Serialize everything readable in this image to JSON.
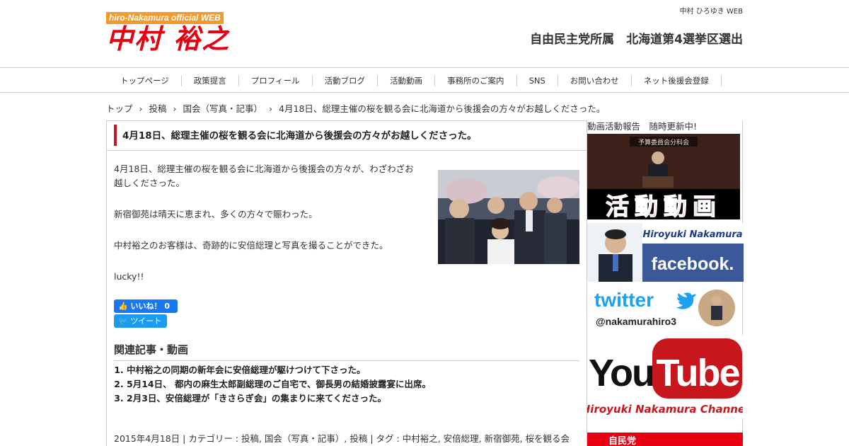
{
  "header": {
    "logo_tag": "hiro-Nakamura official WEB",
    "logo_name": "中村 裕之",
    "top_sub": "中村 ひろゆき WEB",
    "tagline": "自由民主党所属　北海道第4選挙区選出"
  },
  "nav": {
    "items": [
      {
        "label": "トップページ"
      },
      {
        "label": "政策提言"
      },
      {
        "label": "プロフィール"
      },
      {
        "label": "活動ブログ"
      },
      {
        "label": "活動動画"
      },
      {
        "label": "事務所のご案内"
      },
      {
        "label": "SNS"
      },
      {
        "label": "お問い合わせ"
      },
      {
        "label": "ネット後援会登録"
      }
    ]
  },
  "breadcrumb": {
    "items": [
      "トップ",
      "投稿",
      "国会（写真・記事）",
      "4月18日、総理主催の桜を観る会に北海道から後援会の方々がお越しくださった。"
    ]
  },
  "post": {
    "title": "4月18日、総理主催の桜を観る会に北海道から後援会の方々がお越しくださった。",
    "paragraphs": [
      "4月18日、総理主催の桜を観る会に北海道から後援会の方々が、わざわざお越しくださった。",
      "新宿御苑は晴天に恵まれ、多くの方々で賑わった。",
      "中村裕之のお客様は、奇跡的に安倍総理と写真を撮ることができた。",
      "lucky!!"
    ],
    "like_label": "いいね！",
    "like_count": "0",
    "tweet_label": "ツイート",
    "related_heading": "関連記事・動画",
    "related": [
      "中村裕之の同期の新年会に安倍総理が駆けつけて下さった。",
      "5月14日、 都内の麻生太郎副総理のご自宅で、御長男の結婚披露宴に出席。",
      "2月3日、安倍総理が「きさらぎ会」の集まりに来てくださった。"
    ],
    "meta": "2015年4月18日 | カテゴリー : 投稿, 国会（写真・記事）, 投稿 | タグ : 中村裕之, 安倍総理, 新宿御苑, 桜を観る会"
  },
  "sidebar": {
    "heading": "動画活動報告　随時更新中!",
    "video_banner": {
      "top_text": "予算委員会分科会",
      "big_text": "活動動画"
    },
    "fb_banner": {
      "name": "Hiroyuki Nakamura",
      "brand": "facebook."
    },
    "tw_banner": {
      "brand": "twitter",
      "handle": "@nakamurahiro3"
    },
    "yt_banner": {
      "brand_you": "You",
      "brand_tube": "Tube",
      "channel": "Hiroyuki Nakamura Channel"
    },
    "ldp_banner": {
      "text": "自民党"
    }
  },
  "colors": {
    "accent_red": "#e60012",
    "logo_orange": "#f39a2c",
    "facebook_blue": "#3b5998",
    "twitter_blue": "#1da1f2"
  }
}
